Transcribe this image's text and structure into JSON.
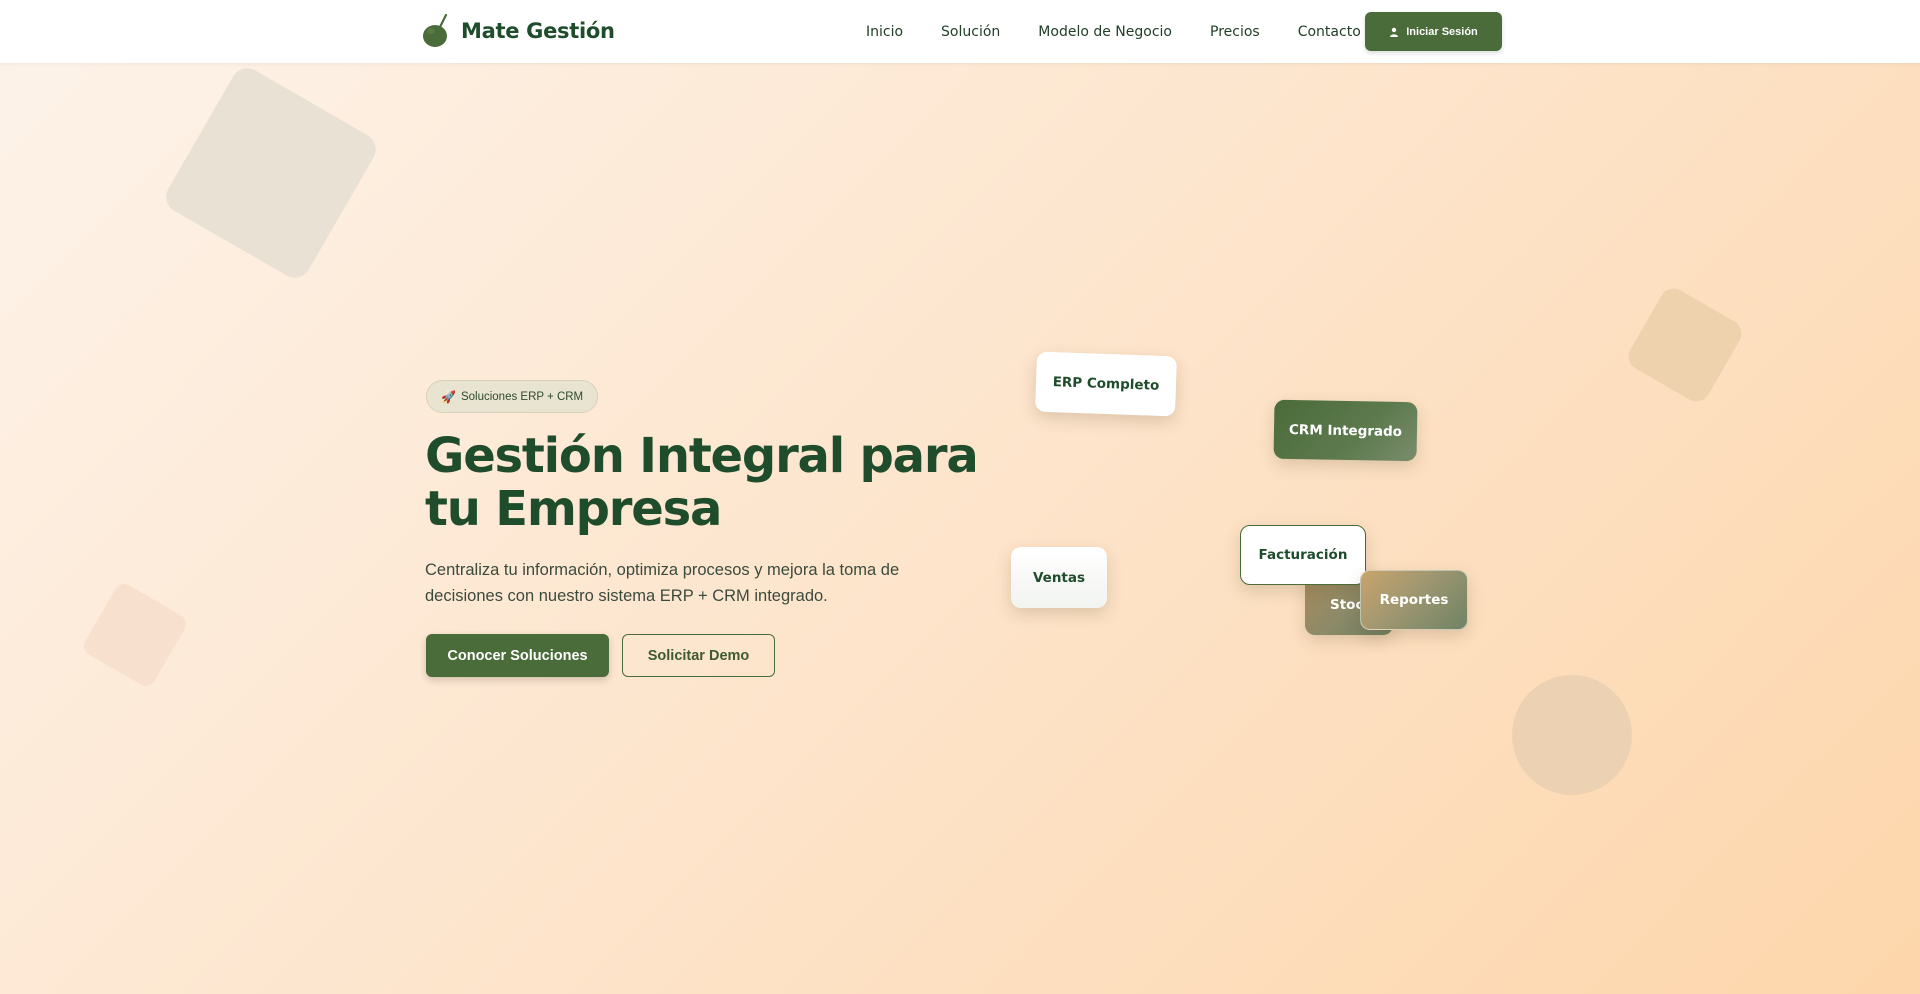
{
  "nav": {
    "brand_name": "Mate Gestión",
    "links": [
      "Inicio",
      "Solución",
      "Modelo de Negocio",
      "Precios",
      "Contacto"
    ],
    "login_label": "Iniciar Sesión"
  },
  "hero": {
    "badge_icon": "🚀",
    "badge_text": "Soluciones ERP + CRM",
    "title_line1": "Gestión Integral para",
    "title_line2": "tu Empresa",
    "description": "Centraliza tu información, optimiza procesos y mejora la toma de decisiones con nuestro sistema ERP + CRM integrado.",
    "primary_button": "Conocer Soluciones",
    "secondary_button": "Solicitar Demo"
  },
  "cards": {
    "erp": "ERP Completo",
    "crm": "CRM Integrado",
    "ventas": "Ventas",
    "facturacion": "Facturación",
    "stock": "Stock",
    "reportes": "Reportes"
  },
  "colors": {
    "brand_green": "#4a6b3a",
    "title_green": "#1f4d2b",
    "background_start": "#fdf3ea",
    "background_end": "#fdd6ab"
  }
}
